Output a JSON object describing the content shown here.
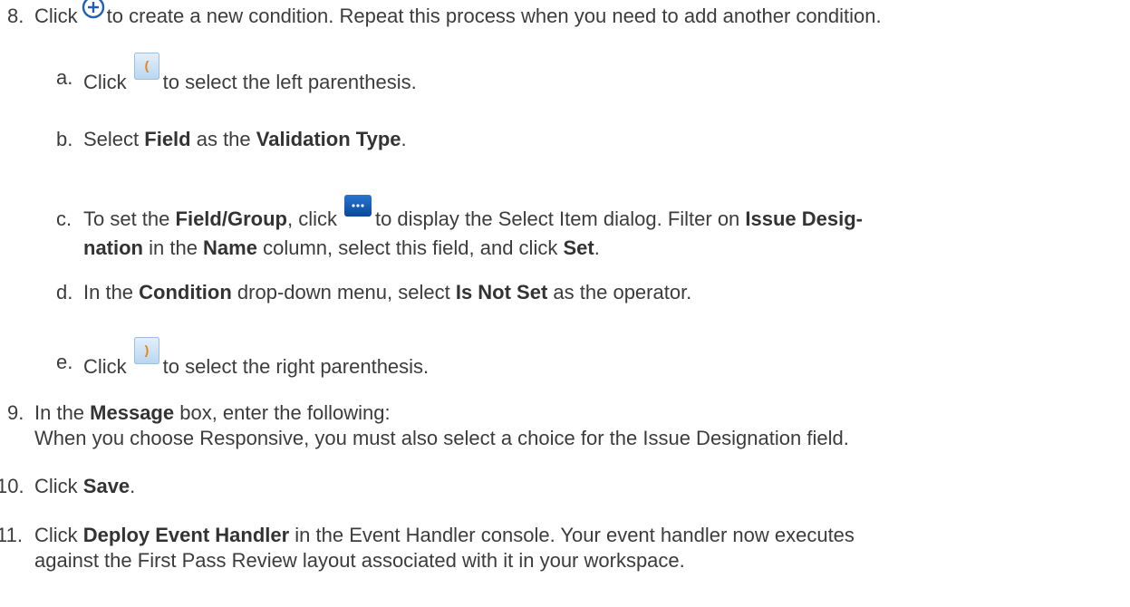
{
  "steps": {
    "s8": {
      "num": "8.",
      "t1": "Click",
      "t2": "to create a new condition. Repeat this process when you need to add another condition."
    },
    "sa": {
      "num": "a.",
      "t1": "Click",
      "t2": "to select the left parenthesis.",
      "icon_glyph": "("
    },
    "sb": {
      "num": "b.",
      "t1": "Select ",
      "b1": "Field",
      "t2": " as the ",
      "b2": "Validation Type",
      "t3": "."
    },
    "sc": {
      "num": "c.",
      "t1": "To set the ",
      "b1": "Field/Group",
      "t2": ", click",
      "t3": "to display the Select Item dialog. Filter on ",
      "b2": "Issue Desig-",
      "l2_b1": "nation",
      "l2_t1": " in the ",
      "l2_b2": "Name",
      "l2_t2": " column, select this field, and click ",
      "l2_b3": "Set",
      "l2_t3": ".",
      "icon_glyph": "..."
    },
    "sd": {
      "num": "d.",
      "t1": "In the ",
      "b1": "Condition",
      "t2": " drop-down menu, select ",
      "b2": "Is Not Set",
      "t3": " as the operator."
    },
    "se": {
      "num": "e.",
      "t1": "Click",
      "t2": "to select the right parenthesis.",
      "icon_glyph": ")"
    },
    "s9": {
      "num": "9.",
      "t1": "In the ",
      "b1": "Message",
      "t2": " box, enter the following:",
      "l2": "When you choose Responsive, you must also select a choice for the Issue Designation field."
    },
    "s10": {
      "num": "10.",
      "t1": "Click ",
      "b1": "Save",
      "t2": "."
    },
    "s11": {
      "num": "11.",
      "t1": "Click ",
      "b1": "Deploy Event Handler",
      "t2": " in the Event Handler console. Your event handler now executes",
      "l2": "against the First Pass Review layout associated with it in your workspace."
    }
  },
  "colors": {
    "text": "#3c3c3c",
    "icon_blue": "#1f5fb4",
    "paren_bg": "#cfe3f5",
    "paren_glyph": "#e8820c",
    "dots_bg": "#0b57b5"
  },
  "icons": {
    "add": "plus-circle-icon",
    "left_paren": "left-parenthesis-icon",
    "right_paren": "right-parenthesis-icon",
    "ellipsis": "ellipsis-button-icon"
  }
}
